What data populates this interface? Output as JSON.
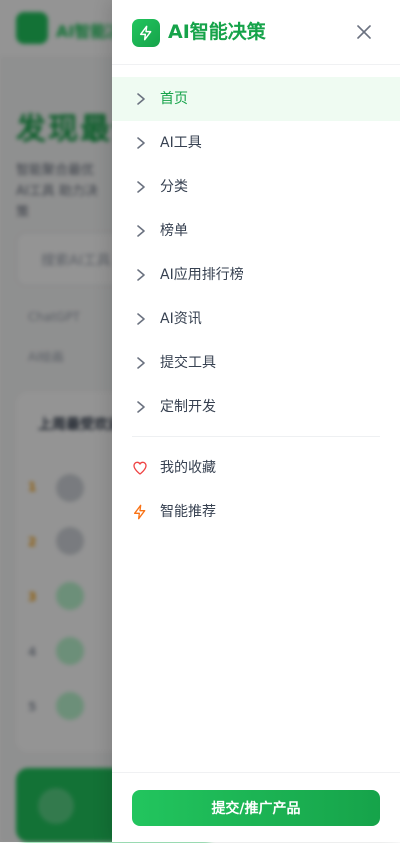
{
  "background": {
    "logo_text": "AI智能决策",
    "hero_title": "发现最佳AI工具",
    "hero_subtitle": "智能聚合最优AI工具 助力决策",
    "search_placeholder": "搜索AI工具",
    "tags": [
      "ChatGPT",
      "AI绘画"
    ],
    "card_title": "上周最受欢迎",
    "ranks": [
      "1",
      "2",
      "3",
      "4",
      "5"
    ]
  },
  "drawer": {
    "brand_title": "AI智能决策",
    "brand_icon": "lightning-icon",
    "close_icon": "close-icon",
    "nav_items": [
      {
        "label": "首页",
        "active": true
      },
      {
        "label": "AI工具",
        "active": false
      },
      {
        "label": "分类",
        "active": false
      },
      {
        "label": "榜单",
        "active": false
      },
      {
        "label": "AI应用排行榜",
        "active": false
      },
      {
        "label": "AI资讯",
        "active": false
      },
      {
        "label": "提交工具",
        "active": false
      },
      {
        "label": "定制开发",
        "active": false
      }
    ],
    "extra_items": [
      {
        "label": "我的收藏",
        "icon": "heart-icon",
        "color": "#ef4444"
      },
      {
        "label": "智能推荐",
        "icon": "lightning-icon",
        "color": "#f97316"
      }
    ],
    "submit_label": "提交/推广产品"
  },
  "colors": {
    "accent": "#16a34a",
    "accent_light": "#22c55e",
    "active_bg": "#effbf2"
  }
}
